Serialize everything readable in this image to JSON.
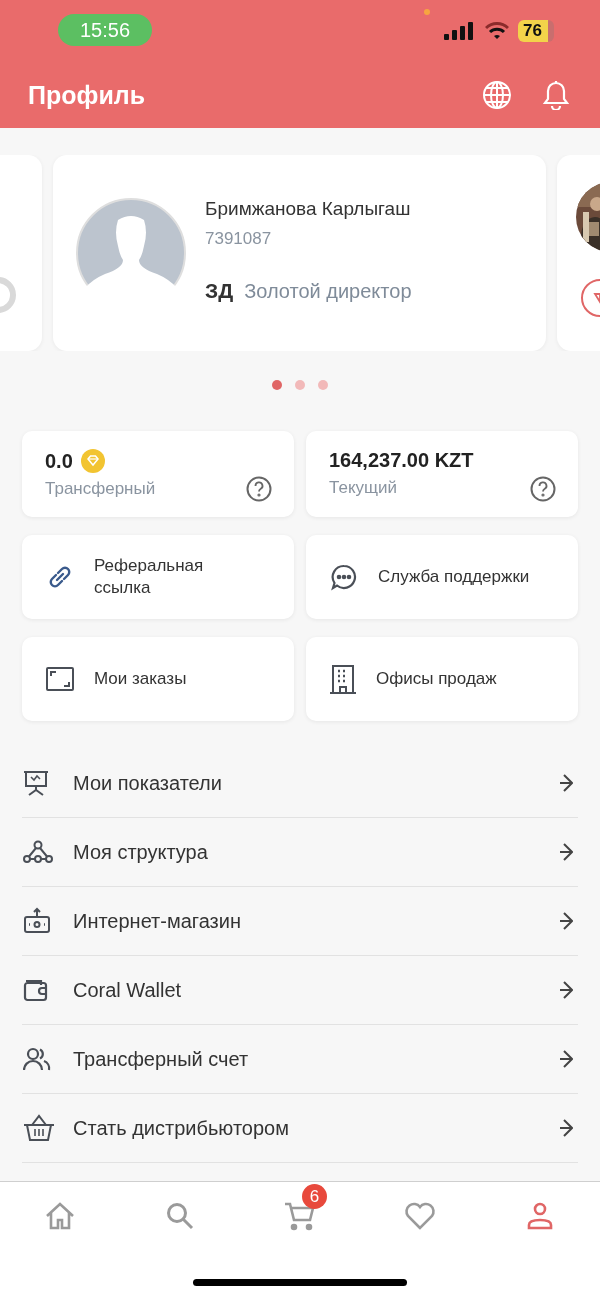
{
  "status_bar": {
    "time": "15:56",
    "battery": "76"
  },
  "header": {
    "title": "Профиль"
  },
  "profile": {
    "name": "Бримжанова Карлыгаш",
    "id": "7391087",
    "rank_code": "ЗД",
    "rank_title": "Золотой директор"
  },
  "carousel_pages": [
    {
      "selected": true
    },
    {
      "selected": false
    },
    {
      "selected": false
    }
  ],
  "balances": [
    {
      "kind": "bonus",
      "value": "0.0",
      "label": "Трансферный"
    },
    {
      "kind": "money",
      "value": "164,237.00 KZT",
      "label": "Текущий"
    }
  ],
  "shortcuts": [
    {
      "label": "Реферальная ссылка"
    },
    {
      "label": "Служба поддержки"
    },
    {
      "label": "Мои заказы"
    },
    {
      "label": "Офисы продаж"
    }
  ],
  "menu": [
    {
      "label": "Мои показатели"
    },
    {
      "label": "Моя структура"
    },
    {
      "label": "Интернет-магазин"
    },
    {
      "label": "Coral Wallet"
    },
    {
      "label": "Трансферный счет"
    },
    {
      "label": "Стать дистрибьютором"
    }
  ],
  "bottom_nav": [
    {
      "selected": false
    },
    {
      "selected": false
    },
    {
      "selected": false,
      "badge": "6"
    },
    {
      "selected": false
    },
    {
      "selected": true
    }
  ]
}
